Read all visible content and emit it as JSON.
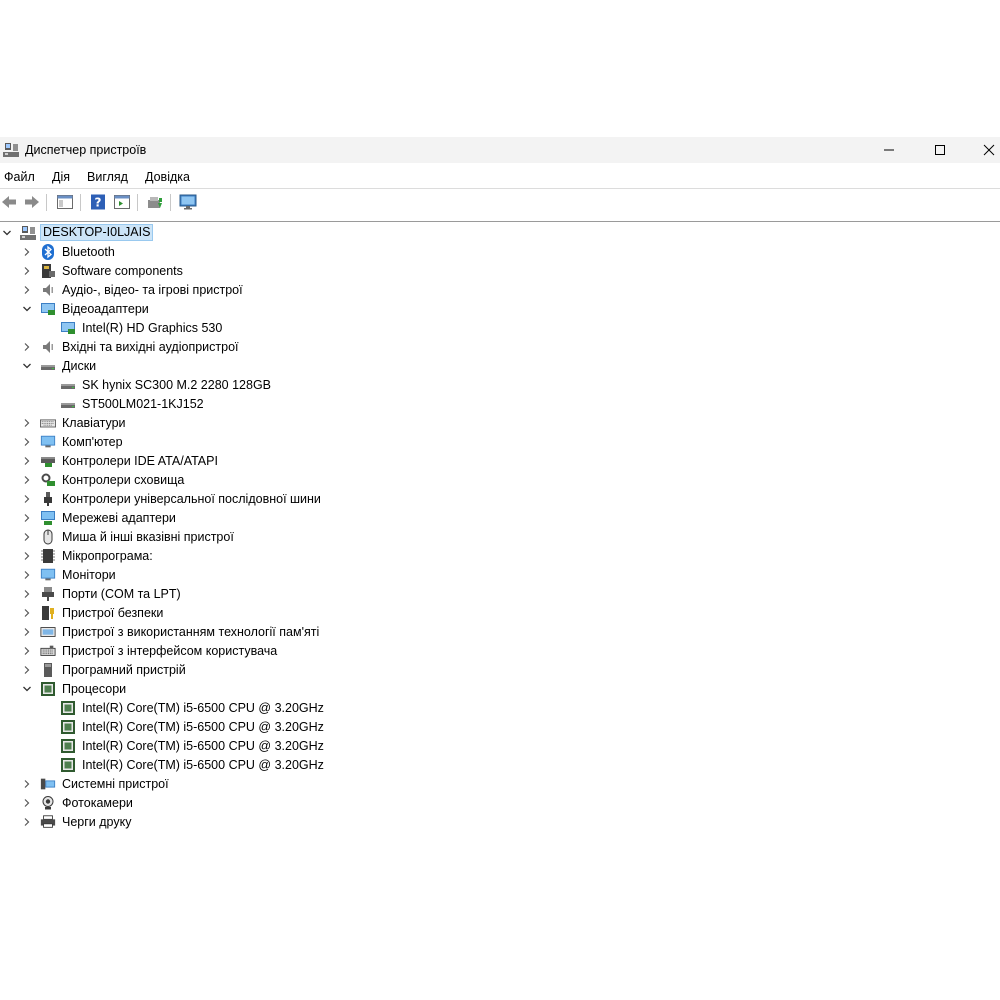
{
  "window": {
    "title": "Диспетчер пристроїв"
  },
  "menu": [
    "Файл",
    "Дія",
    "Вигляд",
    "Довідка"
  ],
  "tree": {
    "root": "DESKTOP-I0LJAIS",
    "categories": [
      {
        "label": "Bluetooth",
        "icon": "bluetooth-icon",
        "expanded": false
      },
      {
        "label": "Software components",
        "icon": "software-components-icon",
        "expanded": false
      },
      {
        "label": "Аудіо-, відео- та ігрові пристрої",
        "icon": "speaker-icon",
        "expanded": false
      },
      {
        "label": "Відеоадаптери",
        "icon": "display-adapter-icon",
        "expanded": true,
        "children": [
          "Intel(R) HD Graphics 530"
        ]
      },
      {
        "label": "Вхідні та вихідні аудіопристрої",
        "icon": "speaker-icon",
        "expanded": false
      },
      {
        "label": "Диски",
        "icon": "disk-drive-icon",
        "expanded": true,
        "children": [
          "SK hynix SC300 M.2 2280 128GB",
          "ST500LM021-1KJ152"
        ]
      },
      {
        "label": "Клавіатури",
        "icon": "keyboard-icon",
        "expanded": false
      },
      {
        "label": "Комп'ютер",
        "icon": "computer-icon",
        "expanded": false
      },
      {
        "label": "Контролери IDE ATA/ATAPI",
        "icon": "ide-controller-icon",
        "expanded": false
      },
      {
        "label": "Контролери сховища",
        "icon": "storage-controller-icon",
        "expanded": false
      },
      {
        "label": "Контролери універсальної послідовної шини",
        "icon": "usb-icon",
        "expanded": false
      },
      {
        "label": "Мережеві адаптери",
        "icon": "network-adapter-icon",
        "expanded": false
      },
      {
        "label": "Миша й інші вказівні пристрої",
        "icon": "mouse-icon",
        "expanded": false
      },
      {
        "label": "Мікропрограма:",
        "icon": "firmware-icon",
        "expanded": false
      },
      {
        "label": "Монітори",
        "icon": "monitor-icon",
        "expanded": false
      },
      {
        "label": "Порти (COM та LPT)",
        "icon": "port-icon",
        "expanded": false
      },
      {
        "label": "Пристрої безпеки",
        "icon": "security-device-icon",
        "expanded": false
      },
      {
        "label": "Пристрої з використанням технології пам'яті",
        "icon": "memory-device-icon",
        "expanded": false
      },
      {
        "label": "Пристрої з інтерфейсом користувача",
        "icon": "hid-icon",
        "expanded": false
      },
      {
        "label": "Програмний пристрій",
        "icon": "software-device-icon",
        "expanded": false
      },
      {
        "label": "Процесори",
        "icon": "processor-icon",
        "expanded": true,
        "children": [
          "Intel(R) Core(TM) i5-6500 CPU @ 3.20GHz",
          "Intel(R) Core(TM) i5-6500 CPU @ 3.20GHz",
          "Intel(R) Core(TM) i5-6500 CPU @ 3.20GHz",
          "Intel(R) Core(TM) i5-6500 CPU @ 3.20GHz"
        ]
      },
      {
        "label": "Системні пристрої",
        "icon": "system-device-icon",
        "expanded": false
      },
      {
        "label": "Фотокамери",
        "icon": "camera-icon",
        "expanded": false
      },
      {
        "label": "Черги друку",
        "icon": "printer-icon",
        "expanded": false
      }
    ]
  }
}
